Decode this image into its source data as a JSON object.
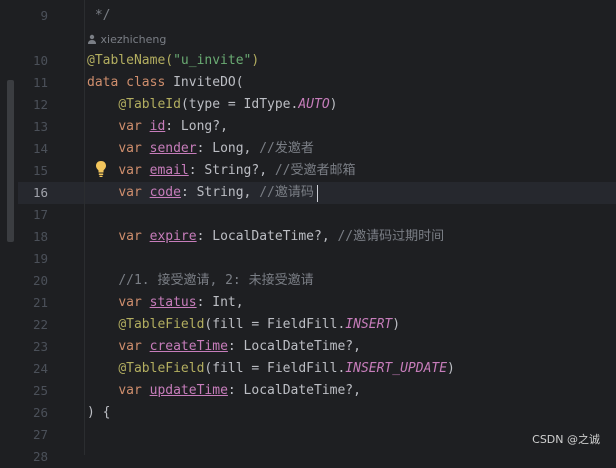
{
  "line_numbers": [
    "9",
    "10",
    "11",
    "12",
    "13",
    "14",
    "15",
    "16",
    "17",
    "18",
    "19",
    "20",
    "21",
    "22",
    "23",
    "24",
    "25",
    "26",
    "27",
    "28"
  ],
  "author_hint": "xiezhicheng",
  "active_line": "16",
  "code": {
    "l9": " */",
    "l10_ann": "@TableName(",
    "l10_str": "\"u_invite\"",
    "l10_end": ")",
    "l11_kw": "data class",
    "l11_rest": " InviteDO(",
    "l12_ann": "@TableId",
    "l12_rest": "(type = IdType.",
    "l12_enum": "AUTO",
    "l12_end": ")",
    "l13_kw": "var",
    "l13_prop": "id",
    "l13_rest": ": Long?,",
    "l14_kw": "var",
    "l14_prop": "sender",
    "l14_rest": ": Long, ",
    "l14_cmt": "//发邀者",
    "l15_kw": "var",
    "l15_prop": "email",
    "l15_rest": ": String?, ",
    "l15_cmt": "//受邀者邮箱",
    "l16_kw": "var",
    "l16_prop": "code",
    "l16_rest": ": String, ",
    "l16_cmt": "//邀请码",
    "l18_kw": "var",
    "l18_prop": "expire",
    "l18_rest": ": LocalDateTime?, ",
    "l18_cmt": "//邀请码过期时间",
    "l20_cmt": "//1. 接受邀请, 2: 未接受邀请",
    "l21_kw": "var",
    "l21_prop": "status",
    "l21_rest": ": Int,",
    "l22_ann": "@TableField",
    "l22_rest": "(fill = FieldFill.",
    "l22_enum": "INSERT",
    "l22_end": ")",
    "l23_kw": "var",
    "l23_prop": "createTime",
    "l23_rest": ": LocalDateTime?,",
    "l24_ann": "@TableField",
    "l24_rest": "(fill = FieldFill.",
    "l24_enum": "INSERT_UPDATE",
    "l24_end": ")",
    "l25_kw": "var",
    "l25_prop": "updateTime",
    "l25_rest": ": LocalDateTime?,",
    "l26": ") {"
  },
  "watermark": "CSDN @之诚",
  "colors": {
    "background": "#1e1f22",
    "annotation": "#b3ae60",
    "keyword": "#cf8e6d",
    "string": "#6aab73",
    "property": "#c77dbb",
    "comment": "#7a7e85"
  },
  "icons": [
    "user-icon",
    "lightbulb-icon"
  ]
}
